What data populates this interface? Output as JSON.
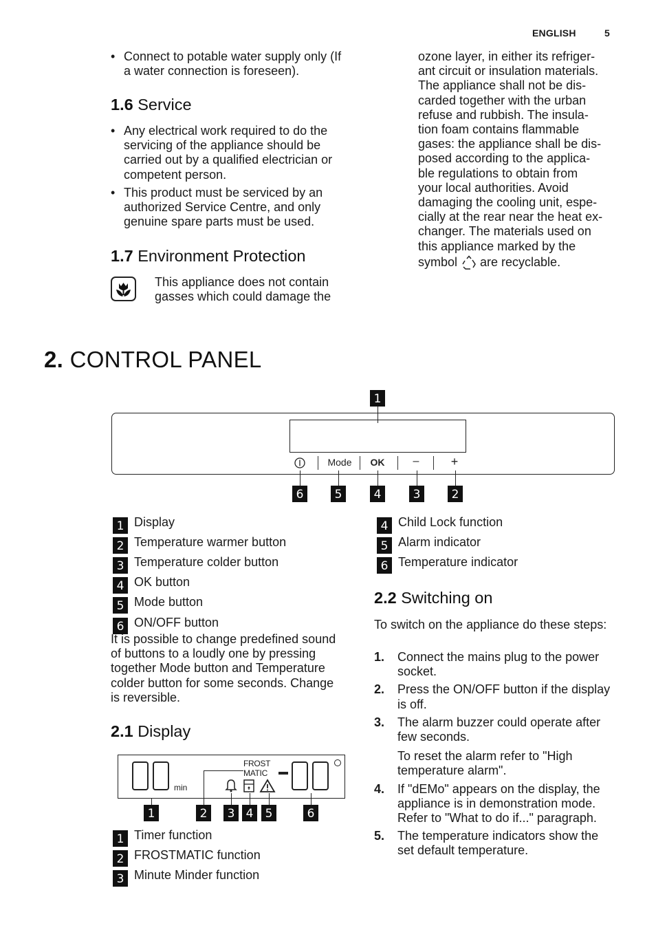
{
  "header": {
    "language": "ENGLISH",
    "page_number": "5"
  },
  "section_1": {
    "intro_bullets": [
      "Connect to potable water supply only (If a water connection is foreseen)."
    ],
    "service": {
      "number": "1.6",
      "title": "Service",
      "bullets": [
        "Any electrical work required to do the servicing of the appliance should be carried out by a qualified electrician or competent person.",
        "This product must be serviced by an authorized Service Centre, and only genuine spare parts must be used."
      ]
    },
    "environment": {
      "number": "1.7",
      "title": "Environment Protection",
      "icon": "ozone-safe-flower-icon",
      "text_left": "This appliance does not contain gasses which could damage the",
      "text_right_lines": [
        "ozone layer, in either its refriger-",
        "ant circuit or insulation materials.",
        "The appliance shall not be dis-",
        "carded together with the urban",
        "refuse and rubbish. The insula-",
        "tion foam contains flammable",
        "gases: the appliance shall be dis-",
        "posed according to the applica-",
        "ble regulations to obtain from",
        "your local authorities. Avoid",
        "damaging the cooling unit, espe-",
        "cially at the rear near the heat ex-",
        "changer. The materials used on",
        "this appliance marked by the"
      ],
      "last_line_before_icon": "symbol",
      "recycle_icon": "recycle-icon",
      "last_line_after_icon": "are recyclable."
    }
  },
  "chapter_2": {
    "number": "2.",
    "title": "CONTROL PANEL",
    "panel_diagram": {
      "buttons": [
        {
          "id": "onoff",
          "label": "Ⓘ",
          "icon": "power-icon",
          "callout": "6"
        },
        {
          "id": "mode",
          "label": "Mode",
          "callout": "5"
        },
        {
          "id": "ok",
          "label": "OK",
          "callout": "4"
        },
        {
          "id": "minus",
          "label": "–",
          "icon": "minus-icon",
          "callout": "3"
        },
        {
          "id": "plus",
          "label": "+",
          "icon": "plus-icon",
          "callout": "2"
        }
      ],
      "display_callout": "1"
    },
    "legend_left": [
      {
        "num": "1",
        "label": "Display"
      },
      {
        "num": "2",
        "label": "Temperature warmer button"
      },
      {
        "num": "3",
        "label": "Temperature colder button"
      },
      {
        "num": "4",
        "label": "OK button"
      },
      {
        "num": "5",
        "label": "Mode button"
      },
      {
        "num": "6",
        "label": "ON/OFF button"
      }
    ],
    "legend_right": [
      {
        "num": "4",
        "label": "Child Lock function"
      },
      {
        "num": "5",
        "label": "Alarm indicator"
      },
      {
        "num": "6",
        "label": "Temperature indicator"
      }
    ],
    "sound_note": "It is possible to change predefined sound of buttons to a loudly one by pressing together Mode button and Temperature colder button for some seconds. Change is reversible.",
    "display_section": {
      "number": "2.1",
      "title": "Display",
      "diagram": {
        "timer_unit": "min",
        "frostmatic_line1": "FROST",
        "frostmatic_line2": "MATIC",
        "minus_sign": "-",
        "degree_symbol": "°",
        "callouts": [
          "1",
          "2",
          "3",
          "4",
          "5",
          "6"
        ]
      },
      "legend": [
        {
          "num": "1",
          "label": "Timer function"
        },
        {
          "num": "2",
          "label": "FROSTMATIC function"
        },
        {
          "num": "3",
          "label": "Minute Minder function"
        }
      ]
    },
    "switching_on": {
      "number": "2.2",
      "title": "Switching on",
      "intro": "To switch on the appliance do these steps:",
      "steps": [
        {
          "num": "1.",
          "text": "Connect the mains plug to the power socket."
        },
        {
          "num": "2.",
          "text": "Press the ON/OFF button if the display is off."
        },
        {
          "num": "3.",
          "text": "The alarm buzzer could operate after few seconds.",
          "note": "To reset the alarm refer to \"High temperature alarm\"."
        },
        {
          "num": "4.",
          "text": "If \"dEMo\" appears on the display, the appliance is in demonstration mode. Refer to \"What to do if...\" paragraph."
        },
        {
          "num": "5.",
          "text": "The temperature indicators show the set default temperature."
        }
      ]
    }
  }
}
